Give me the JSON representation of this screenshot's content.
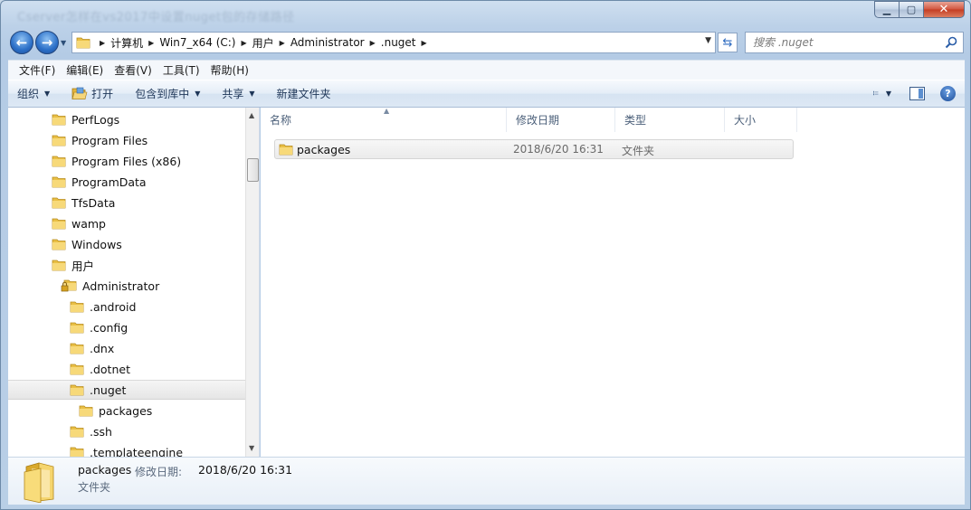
{
  "window": {
    "title": "Cserver怎样在vs2017中设置nuget包的存储路径"
  },
  "address": {
    "crumbs": [
      "计算机",
      "Win7_x64 (C:)",
      "用户",
      "Administrator",
      ".nuget"
    ]
  },
  "search": {
    "placeholder": "搜索 .nuget"
  },
  "menu": [
    "文件(F)",
    "编辑(E)",
    "查看(V)",
    "工具(T)",
    "帮助(H)"
  ],
  "toolbar": {
    "organize": "组织",
    "open": "打开",
    "include_in_library": "包含到库中",
    "share": "共享",
    "new_folder": "新建文件夹"
  },
  "tree": [
    {
      "label": "PerfLogs",
      "indent": 0,
      "icon": "folder"
    },
    {
      "label": "Program Files",
      "indent": 0,
      "icon": "folder"
    },
    {
      "label": "Program Files (x86)",
      "indent": 0,
      "icon": "folder"
    },
    {
      "label": "ProgramData",
      "indent": 0,
      "icon": "folder"
    },
    {
      "label": "TfsData",
      "indent": 0,
      "icon": "folder"
    },
    {
      "label": "wamp",
      "indent": 0,
      "icon": "folder"
    },
    {
      "label": "Windows",
      "indent": 0,
      "icon": "folder"
    },
    {
      "label": "用户",
      "indent": 0,
      "icon": "folder"
    },
    {
      "label": "Administrator",
      "indent": 1,
      "icon": "locked-folder"
    },
    {
      "label": ".android",
      "indent": 2,
      "icon": "folder"
    },
    {
      "label": ".config",
      "indent": 2,
      "icon": "folder"
    },
    {
      "label": ".dnx",
      "indent": 2,
      "icon": "folder"
    },
    {
      "label": ".dotnet",
      "indent": 2,
      "icon": "folder"
    },
    {
      "label": ".nuget",
      "indent": 2,
      "icon": "folder",
      "selected": true
    },
    {
      "label": "packages",
      "indent": 3,
      "icon": "folder"
    },
    {
      "label": ".ssh",
      "indent": 2,
      "icon": "folder"
    },
    {
      "label": ".templateengine",
      "indent": 2,
      "icon": "folder"
    }
  ],
  "columns": {
    "name": "名称",
    "modified": "修改日期",
    "type": "类型",
    "size": "大小"
  },
  "files": [
    {
      "name": "packages",
      "modified": "2018/6/20 16:31",
      "type": "文件夹",
      "size": ""
    }
  ],
  "details": {
    "name": "packages",
    "modified_label": "修改日期:",
    "modified": "2018/6/20 16:31",
    "type": "文件夹"
  },
  "colors": {
    "folder": "#f2cf5a",
    "accent": "#2b6fc7"
  }
}
